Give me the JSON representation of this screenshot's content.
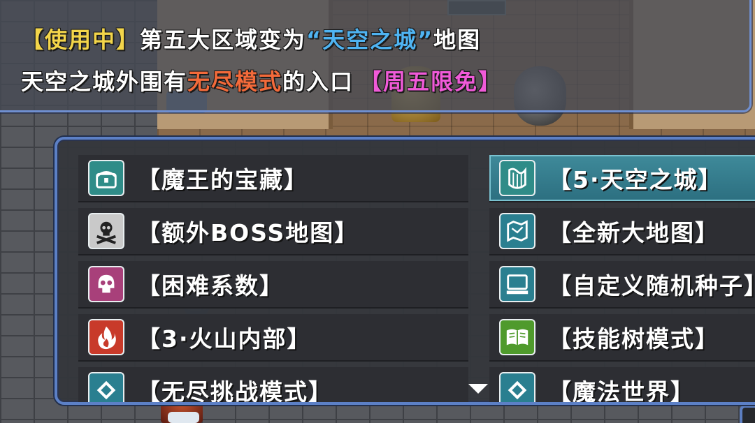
{
  "banner": {
    "line1": {
      "status_tag": "【使用中】",
      "text_a": "第五大区域变为",
      "highlight": "“天空之城”",
      "text_b": "地图"
    },
    "line2": {
      "text_a": "天空之城外围有",
      "highlight": "无尽模式",
      "text_b": "的入口",
      "tag": "【周五限免】"
    }
  },
  "menu": {
    "left": [
      {
        "label": "【魔王的宝藏】",
        "icon": "treasure-chest-icon",
        "color": "#2f8c88"
      },
      {
        "label": "【额外BOSS地图】",
        "icon": "skull-crossbones-icon",
        "color": "#c9c9c9"
      },
      {
        "label": "【困难系数】",
        "icon": "skull-icon",
        "color": "#a8407a"
      },
      {
        "label": "【3·火山内部】",
        "icon": "fire-icon",
        "color": "#c83a2a"
      },
      {
        "label": "【无尽挑战模式】",
        "icon": "diamond-icon",
        "color": "#2a7f90"
      }
    ],
    "right": [
      {
        "label": "【5·天空之城】",
        "icon": "harp-icon",
        "color": "#2f8c88",
        "selected": true
      },
      {
        "label": "【全新大地图】",
        "icon": "map-icon",
        "color": "#2a7f90"
      },
      {
        "label": "【自定义随机种子】",
        "icon": "computer-icon",
        "color": "#2a7f90"
      },
      {
        "label": "【技能树模式】",
        "icon": "book-icon",
        "color": "#4f9a2c"
      },
      {
        "label": "【魔法世界】",
        "icon": "diamond-icon",
        "color": "#2a7f90"
      }
    ]
  },
  "colors": {
    "status_tag": "#f3d54a",
    "sky_city": "#4fb4f2",
    "endless": "#f36a3a",
    "free_tag": "#f05ad8",
    "panel_border": "#5c80c6"
  }
}
